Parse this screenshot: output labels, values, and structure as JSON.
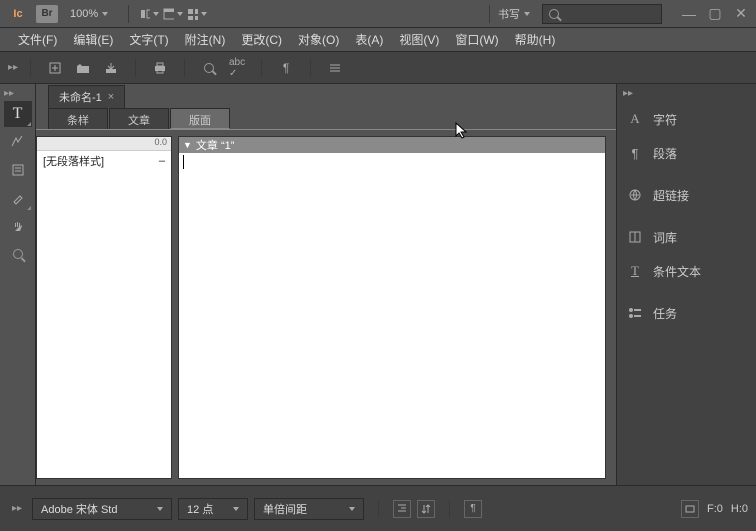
{
  "app": {
    "icon_text": "Ic",
    "br_text": "Br",
    "zoom": "100%"
  },
  "titlebar": {
    "workspace_label": "书写"
  },
  "menu": {
    "file": "文件(F)",
    "edit": "编辑(E)",
    "text": "文字(T)",
    "notes": "附注(N)",
    "change": "更改(C)",
    "object": "对象(O)",
    "table": "表(A)",
    "view": "视图(V)",
    "window": "窗口(W)",
    "help": "帮助(H)"
  },
  "doc_tab": {
    "name": "未命名-1",
    "close": "×"
  },
  "sub_tabs": {
    "styles": "条样",
    "article": "文章",
    "layout": "版面"
  },
  "styles_panel": {
    "header_num": "0.0",
    "no_para_style": "[无段落样式]",
    "marker": "–"
  },
  "editor": {
    "header": "文章 “1”"
  },
  "right_panel": {
    "char": "字符",
    "para": "段落",
    "hyperlink": "超链接",
    "thesaurus": "词库",
    "conditional": "条件文本",
    "tasks": "任务"
  },
  "statusbar": {
    "font": "Adobe 宋体 Std",
    "size": "12 点",
    "spacing": "单倍间距",
    "frame_label": "F:0",
    "height_label": "H:0"
  }
}
